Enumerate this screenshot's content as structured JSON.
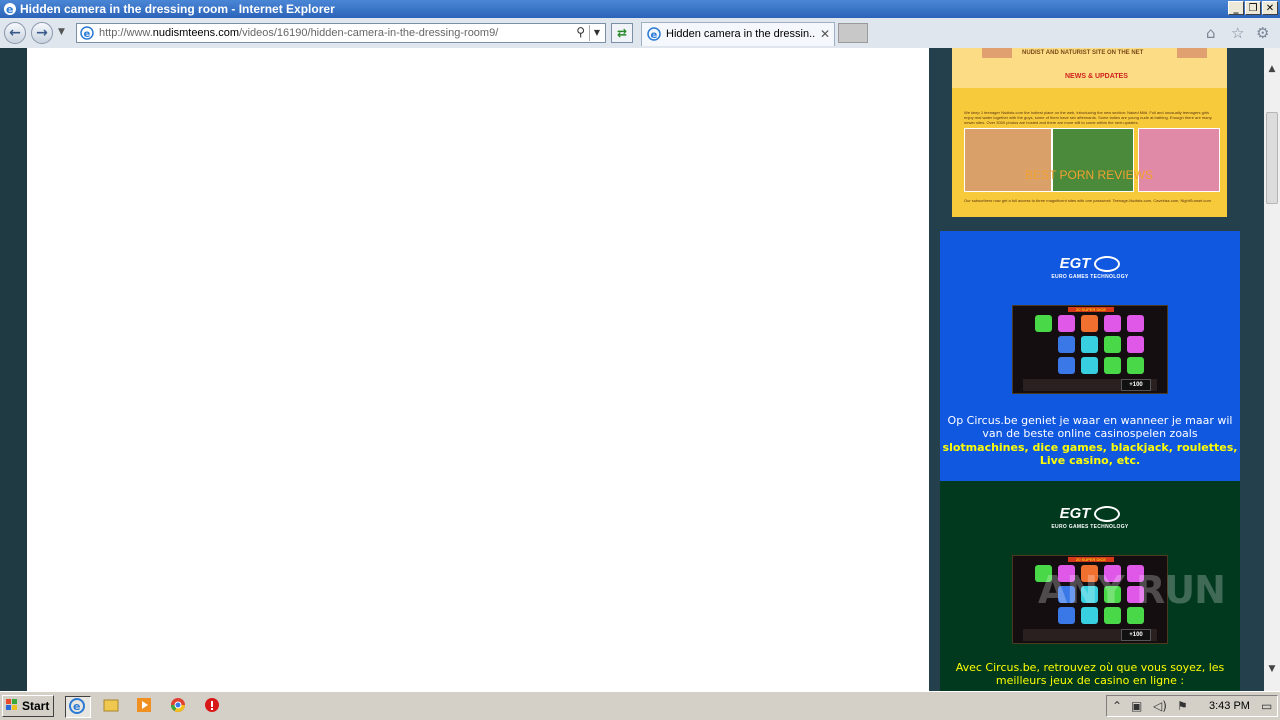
{
  "window": {
    "title": "Hidden camera in the dressing room - Internet Explorer",
    "minimize": "_",
    "restore": "❐",
    "close": "✕"
  },
  "toolbar": {
    "url_prefix": "http://www.",
    "url_domain": "nudismteens.com",
    "url_path": "/videos/16190/hidden-camera-in-the-dressing-room9/",
    "tab_label": "Hidden camera in the dressin...",
    "tab_close": "✕"
  },
  "sidebar": {
    "banner_slogan": "NUDIST AND NATURIST SITE ON THE NET",
    "banner_news": "NEWS & UPDATES",
    "banner_text": "We keep 1 teenager Nudists.com the hottest place on the web, introducing the new section: Naked Mild. Full and unusually teenagers girls enjoy real water together with the guys, some of them have sex afterwards. Some ladies are young nude at bathing. Enough there are many newer sites. Over 3000 photos are hosted and there are more still to come within the next updates.",
    "banner_footer": "Our subscribers now get a full access to three magnificent sites with one password: Teenage-Nudists.com, Cavekiss.com, NightSunset.com",
    "review_link": "BEST PORN REVIEWS"
  },
  "ads": [
    {
      "logo": "EGT",
      "tagline": "EURO GAMES TECHNOLOGY",
      "slot_title": "20 SUPER DICE",
      "win_amount": "+100",
      "text_line1": "Op Circus.be geniet je waar en wanneer je maar wil",
      "text_line2": "van de beste online casinospelen zoals",
      "text_bold1": "slotmachines, dice games, blackjack, roulettes,",
      "text_bold2": "Live casino, etc."
    },
    {
      "logo": "EGT",
      "tagline": "EURO GAMES TECHNOLOGY",
      "slot_title": "20 SUPER DICE",
      "win_amount": "+100",
      "text_line1": "Avec Circus.be, retrouvez où que vous soyez, les",
      "text_line2": "meilleurs jeux de casino en ligne :",
      "text_bold1": "",
      "text_bold2": ""
    }
  ],
  "watermark": "ANY RUN",
  "taskbar": {
    "start_label": "Start",
    "clock": "3:43 PM"
  },
  "colors": {
    "ad_blue": "#1158e0",
    "ad_green": "#00391e",
    "review_orange": "#f3a12f",
    "ad_yellow_text": "#ffff00"
  },
  "icons": {
    "back": "back-arrow-icon",
    "forward": "forward-arrow-icon",
    "home": "home-icon",
    "favorites": "star-icon",
    "tools": "gear-icon"
  }
}
